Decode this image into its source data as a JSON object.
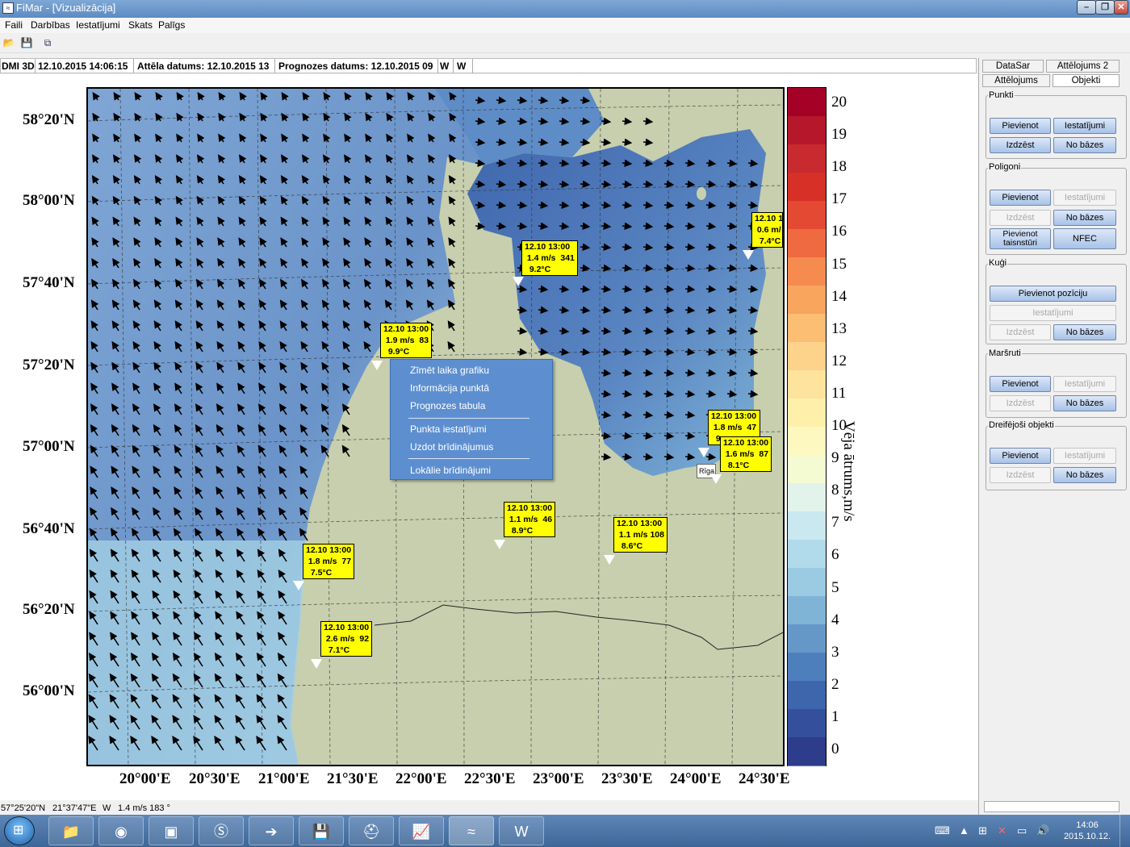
{
  "window": {
    "title": "FiMar - [Vizualizācija]"
  },
  "menu": [
    "Faili",
    "Darbības",
    "Iestatījumi",
    "Skats",
    "Palīgs"
  ],
  "info": {
    "model": "DMI 3D",
    "time": "12.10.2015 14:06:15",
    "image_date": "Attēla datums: 12.10.2015 13",
    "forecast_date": "Prognozes datums: 12.10.2015 09",
    "w1": "W",
    "w2": "W"
  },
  "map": {
    "lat_labels": [
      "58°20'N",
      "58°00'N",
      "57°40'N",
      "57°20'N",
      "57°00'N",
      "56°40'N",
      "56°20'N",
      "56°00'N"
    ],
    "lon_labels": [
      "20°00'E",
      "20°30'E",
      "21°00'E",
      "21°30'E",
      "22°00'E",
      "22°30'E",
      "23°00'E",
      "23°30'E",
      "24°00'E",
      "24°30'E"
    ],
    "legend_title": "Vēja ātrums,m/s",
    "legend_ticks": [
      "20",
      "19",
      "18",
      "17",
      "16",
      "15",
      "14",
      "13",
      "12",
      "11",
      "10",
      "9",
      "8",
      "7",
      "6",
      "5",
      "4",
      "3",
      "2",
      "1",
      "0"
    ],
    "legend_colors": [
      "#a50026",
      "#b6172b",
      "#c82a30",
      "#d73027",
      "#e34933",
      "#f06a41",
      "#f58b4f",
      "#f9a55d",
      "#fbbe72",
      "#fdd28b",
      "#fee39c",
      "#fef0ab",
      "#fdf8c0",
      "#f4fad2",
      "#e2f3ec",
      "#c9e8f0",
      "#b1dbeb",
      "#9acbe2",
      "#7fb4d7",
      "#6598c9",
      "#4d7fbc",
      "#3e66ad",
      "#34509d",
      "#2e3c8c"
    ],
    "stations": [
      {
        "text": "12.10 13:00\n 1.4 m/s  341\n  9.2°C"
      },
      {
        "text": "12.10 1\n 0.6 m/\n  7.4°C"
      },
      {
        "text": "12.10 13:00\n 1.9 m/s  83\n  9.9°C"
      },
      {
        "text": "12.10 13:00\n 1.8 m/s  47\n  9"
      },
      {
        "text": "12.10 13:00\n 1.6 m/s  87\n  8.1°C"
      },
      {
        "text": "12.10 13:00\n 1.1 m/s  46\n  8.9°C"
      },
      {
        "text": "12.10 13:00\n 1.1 m/s 108\n  8.6°C"
      },
      {
        "text": "12.10 13:00\n 1.8 m/s  77\n  7.5°C"
      },
      {
        "text": "12.10 13:00\n 2.6 m/s  92\n  7.1°C"
      }
    ],
    "riga_label": "Rīga"
  },
  "context_menu": {
    "items": [
      "Zīmēt laika grafiku",
      "Informācija punktā",
      "Prognozes tabula",
      "Punkta iestatījumi",
      "Uzdot brīdinājumus",
      "Lokālie brīdinājumi"
    ]
  },
  "panel": {
    "tabs": [
      "DataSar",
      "Attēlojums 2",
      "Attēlojums",
      "Objekti"
    ],
    "groups": {
      "punkti": {
        "title": "Punkti",
        "buttons": [
          "Pievienot",
          "Iestatījumi",
          "Izdzēst",
          "No bāzes"
        ]
      },
      "poligoni": {
        "title": "Poligoni",
        "buttons": [
          "Pievienot",
          "Iestatījumi",
          "Izdzēst",
          "No bāzes",
          "Pievienot taisnstūri",
          "NFEC"
        ]
      },
      "kugi": {
        "title": "Kuģi",
        "buttons": [
          "Pievienot pozīciju",
          "Iestatījumi",
          "Izdzēst",
          "No bāzes"
        ]
      },
      "marsruti": {
        "title": "Maršruti",
        "buttons": [
          "Pievienot",
          "Iestatījumi",
          "Izdzēst",
          "No bāzes"
        ]
      },
      "dreifejosi": {
        "title": "Dreifējoši objekti",
        "buttons": [
          "Pievienot",
          "Iestatījumi",
          "Izdzēst",
          "No bāzes"
        ]
      }
    }
  },
  "status": {
    "lat": "57°25'20\"N",
    "lon": "21°37'47\"E",
    "dir": "W",
    "wind": "1.4 m/s 183 °"
  },
  "taskbar": {
    "clock_time": "14:06",
    "clock_date": "2015.10.12."
  }
}
